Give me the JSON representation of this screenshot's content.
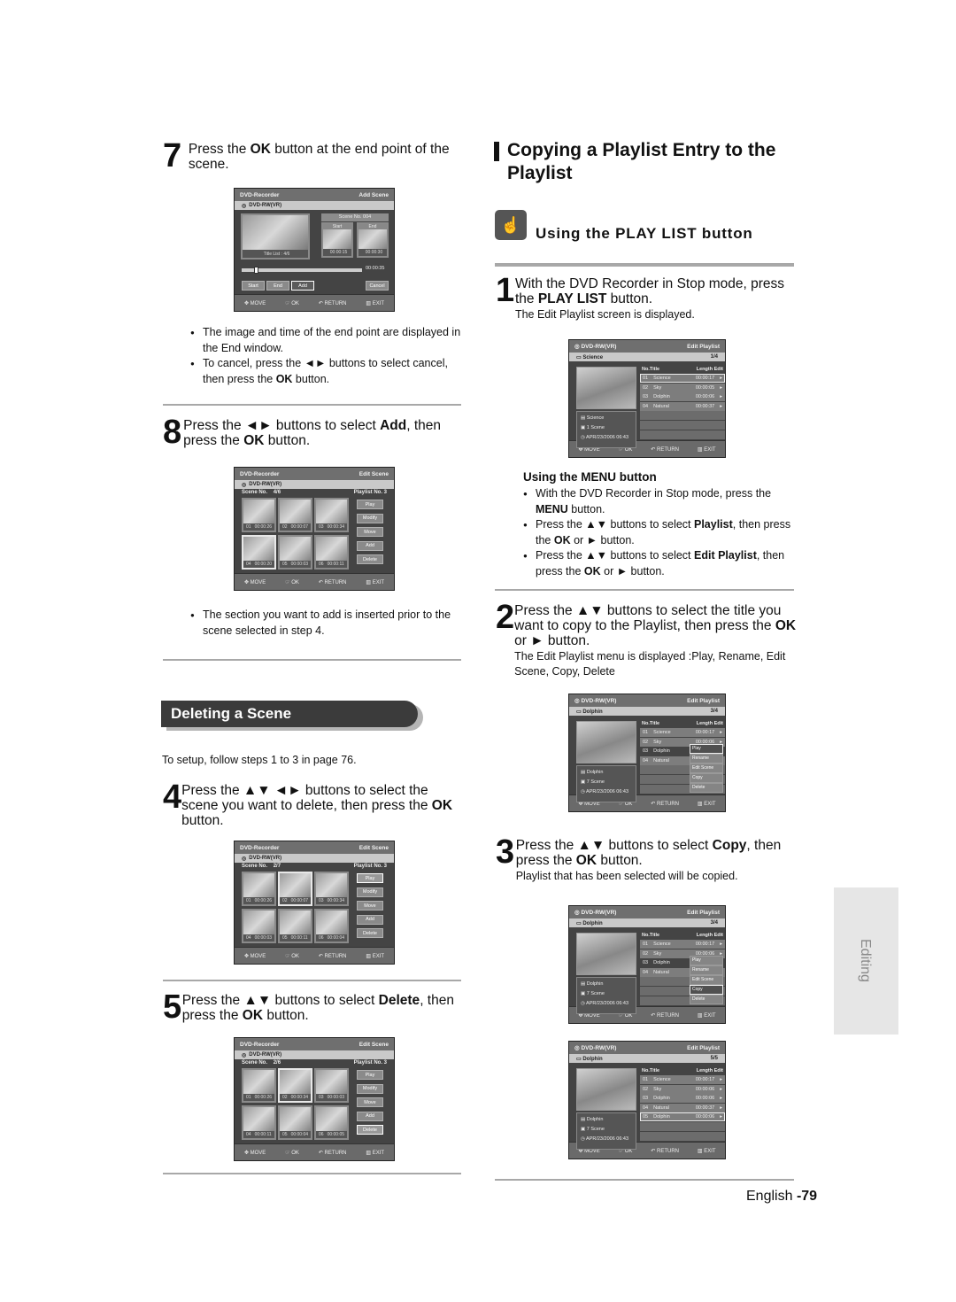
{
  "page": {
    "footer_language": "English",
    "page_number": "-79",
    "side_tab": "Editing"
  },
  "left": {
    "step7": {
      "num": "7",
      "text_pre": "Press the ",
      "text_bold": "OK",
      "text_post": " button at the end point of the scene."
    },
    "screen_add_scene": {
      "header_left": "DVD-Recorder",
      "header_right": "Add Scene",
      "disc": "DVD-RW(VR)",
      "title_list": "Title List : 4/6",
      "scene_no": "Scene No. 004",
      "start_label": "Start",
      "end_label": "End",
      "start_time": "00:00:15",
      "end_time": "00:00:30",
      "progress_time": "00:00:35",
      "progress_fraction": 0.12,
      "buttons": [
        "Start",
        "End",
        "Add",
        "Cancel"
      ],
      "selected_button": "Add",
      "footer": [
        "MOVE",
        "OK",
        "RETURN",
        "EXIT"
      ]
    },
    "bullets7": [
      {
        "text": "The image and time of the end point are displayed in the End window."
      },
      {
        "pre": "To cancel, press the ◄► buttons to select cancel, then press the ",
        "bold": "OK",
        "post": " button."
      }
    ],
    "step8": {
      "num": "8",
      "pre": "Press the ◄► buttons to select ",
      "bold1": "Add",
      "mid": ", then press the ",
      "bold2": "OK",
      "post": " button."
    },
    "screen_edit_scene_a": {
      "header_left": "DVD-Recorder",
      "header_right": "Edit Scene",
      "disc": "DVD-RW(VR)",
      "scene_no_label": "Scene No.",
      "scene_no": "4/6",
      "playlist_no": "Playlist No. 3",
      "thumbs": [
        {
          "no": "01",
          "time": "00:00:26"
        },
        {
          "no": "02",
          "time": "00:00:07"
        },
        {
          "no": "03",
          "time": "00:00:34"
        },
        {
          "no": "04",
          "time": "00:00:20"
        },
        {
          "no": "05",
          "time": "00:00:03"
        },
        {
          "no": "06",
          "time": "00:00:11"
        }
      ],
      "selected_thumb": 3,
      "side_buttons": [
        "Play",
        "Modify",
        "Move",
        "Add",
        "Delete"
      ],
      "footer": [
        "MOVE",
        "OK",
        "RETURN",
        "EXIT"
      ]
    },
    "bullet8": "The section you want to add is inserted prior to the scene selected in step 4.",
    "section_title": "Deleting a Scene",
    "setup_note": "To setup, follow steps 1 to 3 in page 76.",
    "step4": {
      "num": "4",
      "pre": "Press the ▲▼ ◄► buttons to select the scene you want to delete, then press the ",
      "bold": "OK",
      "post": " button."
    },
    "screen_edit_scene_b": {
      "header_left": "DVD-Recorder",
      "header_right": "Edit Scene",
      "disc": "DVD-RW(VR)",
      "scene_no_label": "Scene No.",
      "scene_no": "2/7",
      "playlist_no": "Playlist No. 3",
      "thumbs": [
        {
          "no": "01",
          "time": "00:00:26"
        },
        {
          "no": "02",
          "time": "00:00:07"
        },
        {
          "no": "03",
          "time": "00:00:34"
        },
        {
          "no": "04",
          "time": "00:00:03"
        },
        {
          "no": "05",
          "time": "00:00:11"
        },
        {
          "no": "06",
          "time": "00:00:04"
        }
      ],
      "selected_thumb": 1,
      "selected_button": "Play",
      "side_buttons": [
        "Play",
        "Modify",
        "Move",
        "Add",
        "Delete"
      ],
      "footer": [
        "MOVE",
        "OK",
        "RETURN",
        "EXIT"
      ]
    },
    "step5": {
      "num": "5",
      "pre": "Press the ▲▼ buttons to select ",
      "bold1": "Delete",
      "mid": ", then press the ",
      "bold2": "OK",
      "post": " button."
    },
    "screen_edit_scene_c": {
      "header_left": "DVD-Recorder",
      "header_right": "Edit Scene",
      "disc": "DVD-RW(VR)",
      "scene_no_label": "Scene No.",
      "scene_no": "2/6",
      "playlist_no": "Playlist No. 3",
      "thumbs": [
        {
          "no": "01",
          "time": "00:00:26"
        },
        {
          "no": "02",
          "time": "00:00:34"
        },
        {
          "no": "03",
          "time": "00:00:03"
        },
        {
          "no": "04",
          "time": "00:00:11"
        },
        {
          "no": "05",
          "time": "00:00:04"
        },
        {
          "no": "06",
          "time": "00:00:05"
        }
      ],
      "selected_thumb": 1,
      "selected_button": "Delete",
      "side_buttons": [
        "Play",
        "Modify",
        "Move",
        "Add",
        "Delete"
      ],
      "footer": [
        "MOVE",
        "OK",
        "RETURN",
        "EXIT"
      ]
    }
  },
  "right": {
    "title": "Copying a Playlist Entry to the Playlist",
    "subtitle": "Using the PLAY LIST button",
    "step1": {
      "num": "1",
      "pre": "With the DVD Recorder in Stop mode, press the ",
      "bold": "PLAY LIST",
      "post": " button.",
      "sub": "The Edit Playlist screen is displayed."
    },
    "screen1": {
      "disc": "DVD-RW(VR)",
      "header_right": "Edit Playlist",
      "title": "Science",
      "count": "1/4",
      "info": [
        "Science",
        "1 Scene",
        "APR/23/2006 06:43"
      ],
      "columns": [
        "No.",
        "Title",
        "Length",
        "Edit"
      ],
      "rows": [
        {
          "no": "01",
          "title": "Science",
          "len": "00:00:17"
        },
        {
          "no": "02",
          "title": "Sky",
          "len": "00:00:05"
        },
        {
          "no": "03",
          "title": "Dolphin",
          "len": "00:00:06"
        },
        {
          "no": "04",
          "title": "Natural",
          "len": "00:00:37"
        }
      ],
      "selected_row": 0,
      "footer": [
        "MOVE",
        "OK",
        "RETURN",
        "EXIT"
      ]
    },
    "menu_heading": "Using the MENU button",
    "menu_bullets": [
      {
        "pre": "With the DVD Recorder in Stop mode, press the ",
        "bold": "MENU",
        "post": " button."
      },
      {
        "pre": "Press the ▲▼ buttons to select ",
        "bold": "Playlist",
        "post": ", then press the ",
        "bold2": "OK",
        "post2": " or ► button."
      },
      {
        "pre": "Press the ▲▼ buttons to select ",
        "bold": "Edit Playlist",
        "post": ", then press the ",
        "bold2": "OK",
        "post2": " or ► button."
      }
    ],
    "step2": {
      "num": "2",
      "pre": "Press the ▲▼ buttons to select the title you want to copy to the Playlist, then press the ",
      "bold": "OK",
      "post": " or ► button.",
      "sub": "The Edit Playlist menu is displayed :Play, Rename, Edit Scene, Copy, Delete"
    },
    "screen2": {
      "disc": "DVD-RW(VR)",
      "header_right": "Edit Playlist",
      "title": "Dolphin",
      "count": "3/4",
      "info": [
        "Dolphin",
        "7 Scene",
        "APR/23/2006 06:43"
      ],
      "columns": [
        "No.",
        "Title",
        "Length",
        "Edit"
      ],
      "rows": [
        {
          "no": "01",
          "title": "Science",
          "len": "00:00:17"
        },
        {
          "no": "02",
          "title": "Sky",
          "len": "00:00:06"
        },
        {
          "no": "03",
          "title": "Dolphin",
          "len": ""
        },
        {
          "no": "04",
          "title": "Natural",
          "len": ""
        }
      ],
      "popup": [
        "Play",
        "Rename",
        "Edit Scene",
        "Copy",
        "Delete"
      ],
      "popup_selected": "Play",
      "footer": [
        "MOVE",
        "OK",
        "RETURN",
        "EXIT"
      ]
    },
    "step3": {
      "num": "3",
      "pre": "Press the ▲▼ buttons to select ",
      "bold1": "Copy",
      "mid": ", then press the ",
      "bold2": "OK",
      "post": " button.",
      "sub": "Playlist that has been selected will be copied."
    },
    "screen3": {
      "disc": "DVD-RW(VR)",
      "header_right": "Edit Playlist",
      "title": "Dolphin",
      "count": "3/4",
      "info": [
        "Dolphin",
        "7 Scene",
        "APR/23/2006 06:43"
      ],
      "columns": [
        "No.",
        "Title",
        "Length",
        "Edit"
      ],
      "rows": [
        {
          "no": "01",
          "title": "Science",
          "len": "00:00:17"
        },
        {
          "no": "02",
          "title": "Sky",
          "len": "00:00:06"
        },
        {
          "no": "03",
          "title": "Dolphin",
          "len": ""
        },
        {
          "no": "04",
          "title": "Natural",
          "len": ""
        }
      ],
      "popup": [
        "Play",
        "Rename",
        "Edit Scene",
        "Copy",
        "Delete"
      ],
      "popup_selected": "Copy",
      "footer": [
        "MOVE",
        "OK",
        "RETURN",
        "EXIT"
      ]
    },
    "screen4": {
      "disc": "DVD-RW(VR)",
      "header_right": "Edit Playlist",
      "title": "Dolphin",
      "count": "5/5",
      "info": [
        "Dolphin",
        "7 Scene",
        "APR/23/2006 06:43"
      ],
      "columns": [
        "No.",
        "Title",
        "Length",
        "Edit"
      ],
      "rows": [
        {
          "no": "01",
          "title": "Science",
          "len": "00:00:17"
        },
        {
          "no": "02",
          "title": "Sky",
          "len": "00:00:06"
        },
        {
          "no": "03",
          "title": "Dolphin",
          "len": "00:00:06"
        },
        {
          "no": "04",
          "title": "Natural",
          "len": "00:00:37"
        },
        {
          "no": "05",
          "title": "Dolphin",
          "len": "00:00:06"
        }
      ],
      "selected_row": 4,
      "footer": [
        "MOVE",
        "OK",
        "RETURN",
        "EXIT"
      ]
    }
  }
}
